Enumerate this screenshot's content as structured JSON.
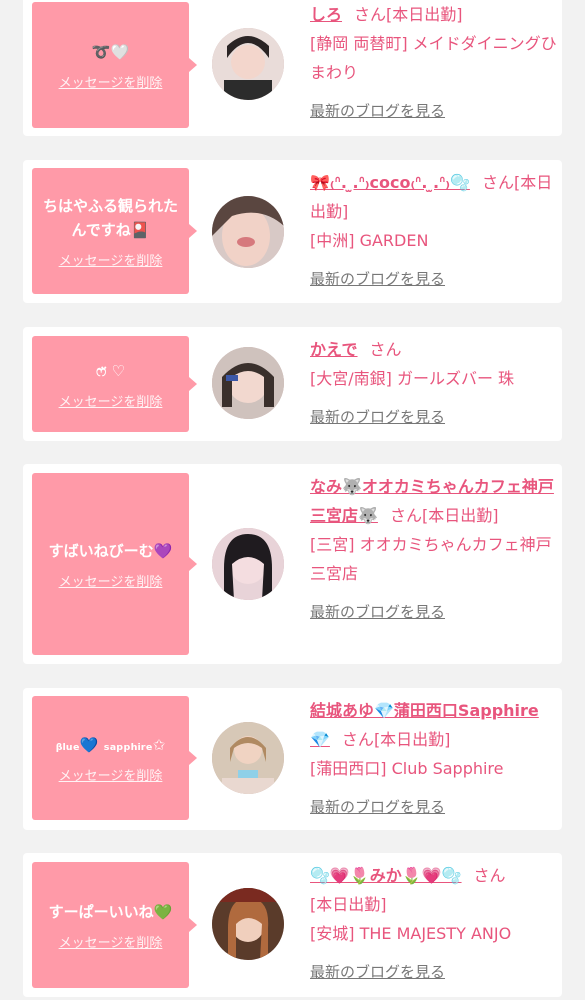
{
  "messages": [
    {
      "message": "➰🤍",
      "delete_label": "メッセージを削除",
      "name": "しろ",
      "honorific": "さん",
      "status": "[本日出勤]",
      "shop": "[静岡 両替町] メイドダイニングひまわり",
      "blog_link": "最新のブログを見る"
    },
    {
      "message": "ちはやふる観られたんですね🎴",
      "delete_label": "メッセージを削除",
      "name": "🎀₍ᐢ. ̫.ᐢ₎coco₍ᐢ. ̫.ᐢ₎🫧",
      "honorific": "さん",
      "status": "[本日出勤]",
      "shop": "[中洲] GARDEN",
      "blog_link": "最新のブログを見る"
    },
    {
      "message": "ෆ̈ ♡",
      "delete_label": "メッセージを削除",
      "name": "かえで",
      "honorific": "さん",
      "status": "",
      "shop": "[大宮/南銀] ガールズバー 珠",
      "blog_link": "最新のブログを見る"
    },
    {
      "message": "すばいねびーむ💜",
      "delete_label": "メッセージを削除",
      "name": "なみ🐺オオカミちゃんカフェ神戸三宮店🐺",
      "honorific": "さん",
      "status": "[本日出勤]",
      "shop": "[三宮] オオカミちゃんカフェ神戸三宮店",
      "blog_link": "最新のブログを見る"
    },
    {
      "message": "ᵦₗᵤₑ💙 ₛₐₚₚₕᵢᵣₑ✩",
      "delete_label": "メッセージを削除",
      "name": "結城あゆ💎蒲田西口Sapphire💎",
      "honorific": "さん",
      "status": "[本日出勤]",
      "shop": "[蒲田西口] Club Sapphire",
      "blog_link": "最新のブログを見る"
    },
    {
      "message": "すーぱーいいね💚",
      "delete_label": "メッセージを削除",
      "name": "🫧💗🌷みか🌷💗🫧",
      "honorific": "さん",
      "status": "[本日出勤]",
      "shop": "[安城] THE MAJESTY ANJO",
      "blog_link": "最新のブログを見る"
    }
  ]
}
